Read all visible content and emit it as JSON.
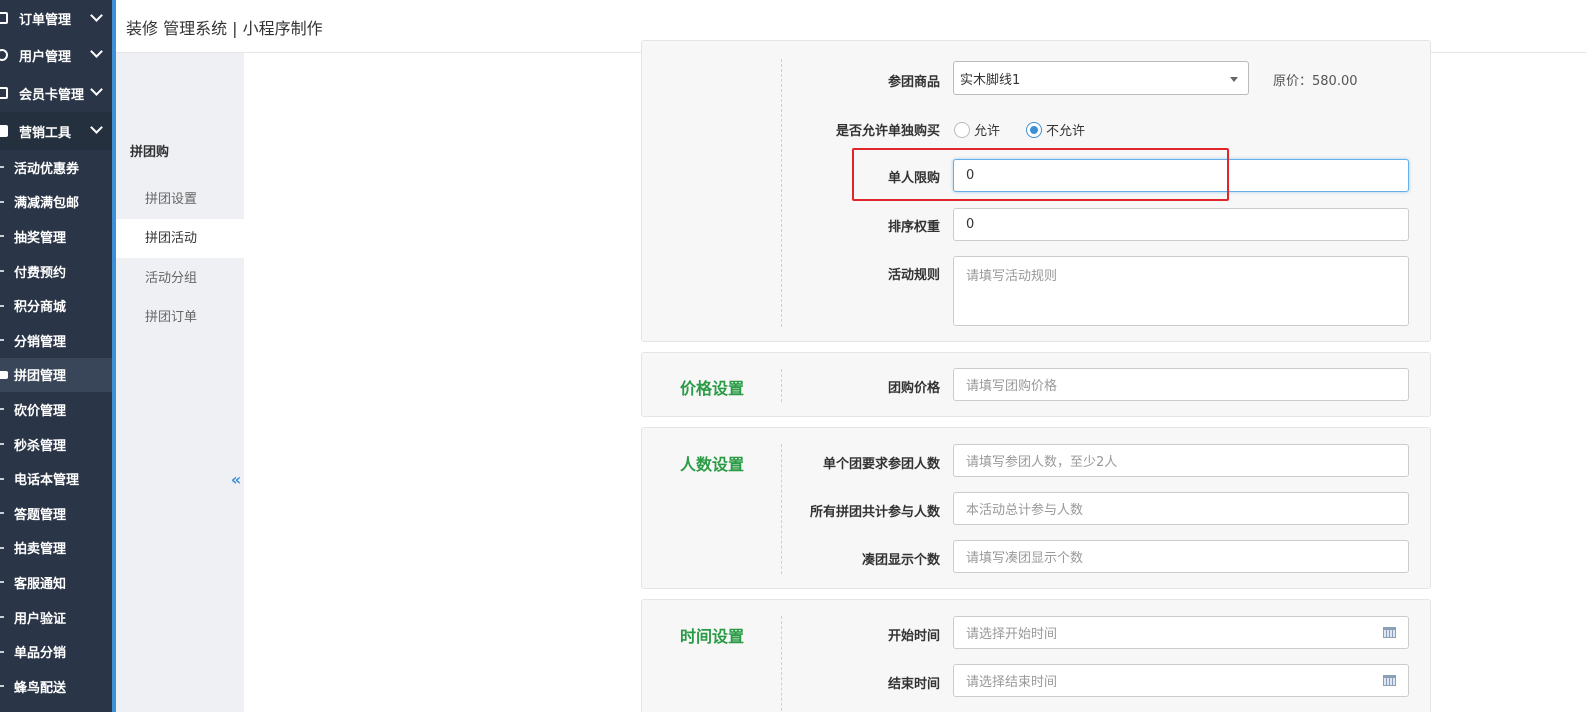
{
  "header": {
    "title": "装修 管理系统 | 小程序制作"
  },
  "sidebar": {
    "groups": [
      {
        "label": "订单管理"
      },
      {
        "label": "用户管理"
      },
      {
        "label": "会员卡管理"
      },
      {
        "label": "营销工具"
      }
    ],
    "items": [
      {
        "label": "活动优惠券"
      },
      {
        "label": "满减满包邮"
      },
      {
        "label": "抽奖管理"
      },
      {
        "label": "付费预约"
      },
      {
        "label": "积分商城"
      },
      {
        "label": "分销管理"
      },
      {
        "label": "拼团管理"
      },
      {
        "label": "砍价管理"
      },
      {
        "label": "秒杀管理"
      },
      {
        "label": "电话本管理"
      },
      {
        "label": "答题管理"
      },
      {
        "label": "拍卖管理"
      },
      {
        "label": "客服通知"
      },
      {
        "label": "用户验证"
      },
      {
        "label": "单品分销"
      },
      {
        "label": "蜂鸟配送"
      }
    ]
  },
  "subnav": {
    "title": "拼团购",
    "items": [
      {
        "label": "拼团设置"
      },
      {
        "label": "拼团活动"
      },
      {
        "label": "活动分组"
      },
      {
        "label": "拼团订单"
      }
    ],
    "collapse_glyph": "«"
  },
  "basic": {
    "product_label": "参团商品",
    "product_value": "实木脚线1",
    "original_price": "原价：580.00",
    "allow_single_label": "是否允许单独购买",
    "allow_option": "允许",
    "disallow_option": "不允许",
    "limit_label": "单人限购",
    "limit_value": "0",
    "sort_label": "排序权重",
    "sort_value": "0",
    "rules_label": "活动规则",
    "rules_placeholder": "请填写活动规则"
  },
  "price": {
    "title": "价格设置",
    "group_price_label": "团购价格",
    "group_price_placeholder": "请填写团购价格"
  },
  "people": {
    "title": "人数设置",
    "per_group_label": "单个团要求参团人数",
    "per_group_placeholder": "请填写参团人数，至少2人",
    "total_label": "所有拼团共计参与人数",
    "total_placeholder": "本活动总计参与人数",
    "display_label": "凑团显示个数",
    "display_placeholder": "请填写凑团显示个数"
  },
  "time": {
    "title": "时间设置",
    "start_label": "开始时间",
    "start_placeholder": "请选择开始时间",
    "end_label": "结束时间",
    "end_placeholder": "请选择结束时间"
  }
}
